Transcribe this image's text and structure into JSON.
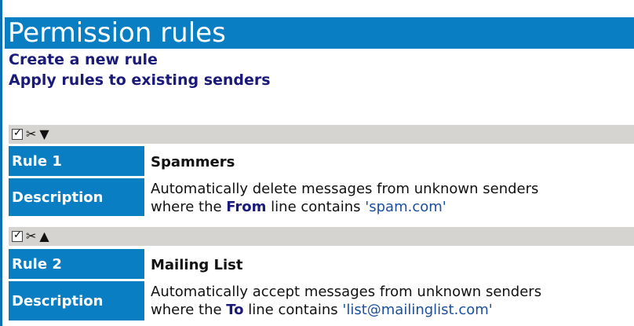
{
  "page": {
    "title": "Permission rules",
    "links": {
      "create": "Create a new rule",
      "apply": "Apply rules to existing senders"
    }
  },
  "rules": [
    {
      "label": "Rule 1",
      "name": "Spammers",
      "description_label": "Description",
      "desc_prefix": "Automatically delete messages from unknown senders",
      "desc_where": "where the ",
      "field": "From",
      "desc_mid": " line contains ",
      "value": "'spam.com'",
      "sort_icon": "arrow-down-icon"
    },
    {
      "label": "Rule 2",
      "name": "Mailing List",
      "description_label": "Description",
      "desc_prefix": "Automatically accept messages from unknown senders",
      "desc_where": "where the ",
      "field": "To",
      "desc_mid": " line contains ",
      "value": "'list@mailinglist.com'",
      "sort_icon": "arrow-up-icon"
    }
  ],
  "colors": {
    "accent": "#0a7ec2",
    "link": "#1a1a7a",
    "toolbar": "#d6d4d0"
  }
}
